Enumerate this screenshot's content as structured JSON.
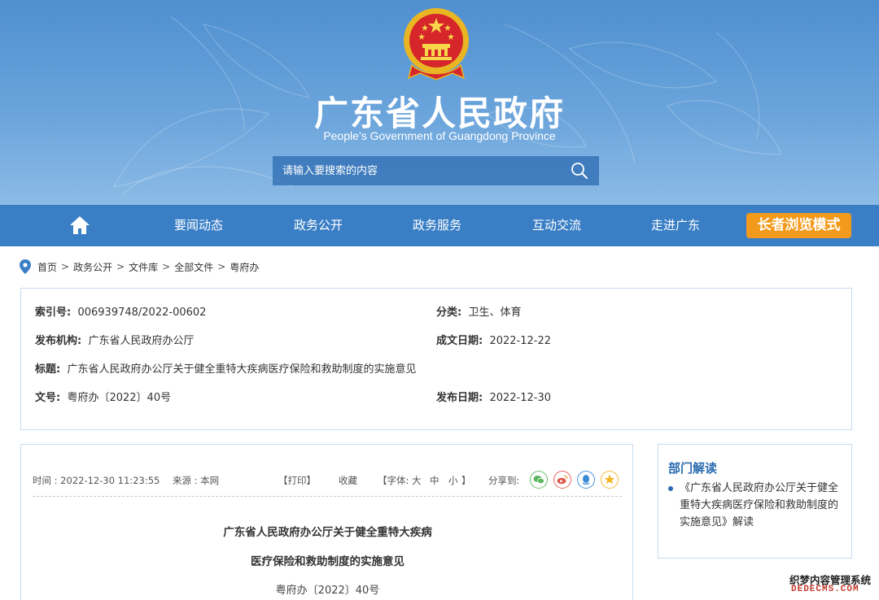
{
  "header": {
    "title": "广东省人民政府",
    "subtitle": "People’s Government of Guangdong Province",
    "search": {
      "placeholder": "请输入要搜索的内容",
      "value": ""
    },
    "bg_color": "#5a98d5"
  },
  "nav": {
    "items": [
      "要闻动态",
      "政务公开",
      "政务服务",
      "互动交流",
      "走进广东"
    ],
    "elder_mode": "长者浏览模式",
    "bg_color": "#3a7fc6",
    "elder_color": "#f39a1c"
  },
  "breadcrumb": [
    "首页",
    "政务公开",
    "文件库",
    "全部文件",
    "粤府办"
  ],
  "info": {
    "index_label": "索引号:",
    "index_value": "006939748/2022-00602",
    "category_label": "分类:",
    "category_value": "卫生、体育",
    "issuer_label": "发布机构:",
    "issuer_value": "广东省人民政府办公厅",
    "created_label": "成文日期:",
    "created_value": "2022-12-22",
    "title_label": "标题:",
    "title_value": "广东省人民政府办公厅关于健全重特大疾病医疗保险和救助制度的实施意见",
    "docno_label": "文号:",
    "docno_value": "粤府办〔2022〕40号",
    "published_label": "发布日期:",
    "published_value": "2022-12-30"
  },
  "article": {
    "time": "时间 : 2022-12-30 11:23:55",
    "source": "来源 : 本网",
    "print": "【打印】",
    "favorite": "收藏",
    "font_open": "【字体:",
    "font_large": "大",
    "font_medium": "中",
    "font_small": "小",
    "font_close": "】",
    "share": "分享到:",
    "title_line1": "广东省人民政府办公厅关于健全重特大疾病",
    "title_line2": "医疗保险和救助制度的实施意见",
    "doc_no": "粤府办〔2022〕40号"
  },
  "sidebar": {
    "title": "部门解读",
    "item": "《广东省人民政府办公厅关于健全重特大疾病医疗保险和救助制度的实施意见》解读"
  },
  "watermark": {
    "line1": "织梦内容管理系统",
    "line2": "DEDECMS.COM"
  }
}
